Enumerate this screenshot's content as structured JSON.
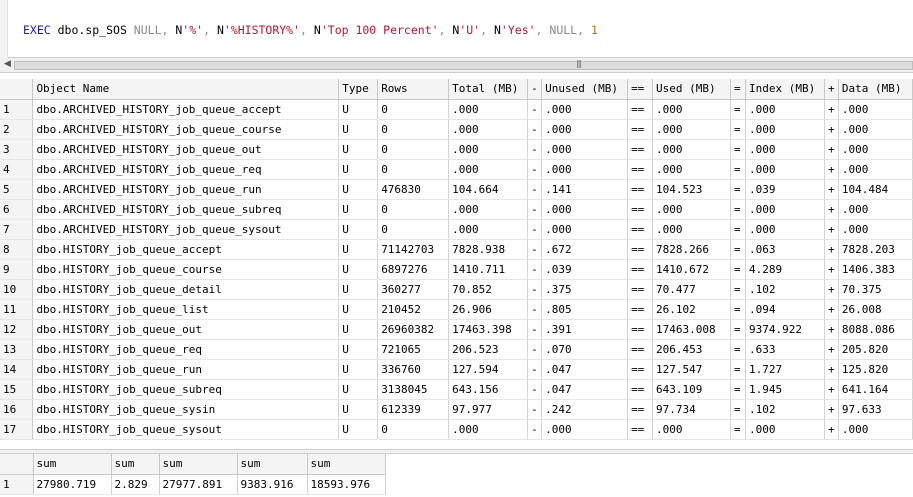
{
  "query": {
    "exec": "EXEC",
    "proc": " dbo.sp_SOS ",
    "null1": "NULL",
    "c1": ", ",
    "n1": "N",
    "s1": "'%'",
    "c2": ", ",
    "n2": "N",
    "s2": "'%HISTORY%'",
    "c3": ", ",
    "n3": "N",
    "s3": "'Top 100 Percent'",
    "c4": ", ",
    "n4": "N",
    "s4": "'U'",
    "c5": ", ",
    "n5": "N",
    "s5": "'Yes'",
    "c6": ", ",
    "null2": "NULL",
    "c7": ", ",
    "last": "1"
  },
  "grid": {
    "headers": [
      "Object Name",
      "Type",
      "Rows",
      "Total (MB)",
      "-",
      "Unused (MB)",
      "==",
      "Used (MB)",
      "=",
      "Index (MB)",
      "+",
      "Data (MB)"
    ],
    "rows": [
      {
        "n": "1",
        "c": [
          "dbo.ARCHIVED_HISTORY_job_queue_accept",
          "U",
          "0",
          ".000",
          "-",
          ".000",
          "==",
          ".000",
          "=",
          ".000",
          "+",
          ".000"
        ]
      },
      {
        "n": "2",
        "c": [
          "dbo.ARCHIVED_HISTORY_job_queue_course",
          "U",
          "0",
          ".000",
          "-",
          ".000",
          "==",
          ".000",
          "=",
          ".000",
          "+",
          ".000"
        ]
      },
      {
        "n": "3",
        "c": [
          "dbo.ARCHIVED_HISTORY_job_queue_out",
          "U",
          "0",
          ".000",
          "-",
          ".000",
          "==",
          ".000",
          "=",
          ".000",
          "+",
          ".000"
        ]
      },
      {
        "n": "4",
        "c": [
          "dbo.ARCHIVED_HISTORY_job_queue_req",
          "U",
          "0",
          ".000",
          "-",
          ".000",
          "==",
          ".000",
          "=",
          ".000",
          "+",
          ".000"
        ]
      },
      {
        "n": "5",
        "c": [
          "dbo.ARCHIVED_HISTORY_job_queue_run",
          "U",
          "476830",
          "104.664",
          "-",
          ".141",
          "==",
          "104.523",
          "=",
          ".039",
          "+",
          "104.484"
        ]
      },
      {
        "n": "6",
        "c": [
          "dbo.ARCHIVED_HISTORY_job_queue_subreq",
          "U",
          "0",
          ".000",
          "-",
          ".000",
          "==",
          ".000",
          "=",
          ".000",
          "+",
          ".000"
        ]
      },
      {
        "n": "7",
        "c": [
          "dbo.ARCHIVED_HISTORY_job_queue_sysout",
          "U",
          "0",
          ".000",
          "-",
          ".000",
          "==",
          ".000",
          "=",
          ".000",
          "+",
          ".000"
        ]
      },
      {
        "n": "8",
        "c": [
          "dbo.HISTORY_job_queue_accept",
          "U",
          "71142703",
          "7828.938",
          "-",
          ".672",
          "==",
          "7828.266",
          "=",
          ".063",
          "+",
          "7828.203"
        ]
      },
      {
        "n": "9",
        "c": [
          "dbo.HISTORY_job_queue_course",
          "U",
          "6897276",
          "1410.711",
          "-",
          ".039",
          "==",
          "1410.672",
          "=",
          "4.289",
          "+",
          "1406.383"
        ]
      },
      {
        "n": "10",
        "c": [
          "dbo.HISTORY_job_queue_detail",
          "U",
          "360277",
          "70.852",
          "-",
          ".375",
          "==",
          "70.477",
          "=",
          ".102",
          "+",
          "70.375"
        ]
      },
      {
        "n": "11",
        "c": [
          "dbo.HISTORY_job_queue_list",
          "U",
          "210452",
          "26.906",
          "-",
          ".805",
          "==",
          "26.102",
          "=",
          ".094",
          "+",
          "26.008"
        ]
      },
      {
        "n": "12",
        "c": [
          "dbo.HISTORY_job_queue_out",
          "U",
          "26960382",
          "17463.398",
          "-",
          ".391",
          "==",
          "17463.008",
          "=",
          "9374.922",
          "+",
          "8088.086"
        ]
      },
      {
        "n": "13",
        "c": [
          "dbo.HISTORY_job_queue_req",
          "U",
          "721065",
          "206.523",
          "-",
          ".070",
          "==",
          "206.453",
          "=",
          ".633",
          "+",
          "205.820"
        ]
      },
      {
        "n": "14",
        "c": [
          "dbo.HISTORY_job_queue_run",
          "U",
          "336760",
          "127.594",
          "-",
          ".047",
          "==",
          "127.547",
          "=",
          "1.727",
          "+",
          "125.820"
        ]
      },
      {
        "n": "15",
        "c": [
          "dbo.HISTORY_job_queue_subreq",
          "U",
          "3138045",
          "643.156",
          "-",
          ".047",
          "==",
          "643.109",
          "=",
          "1.945",
          "+",
          "641.164"
        ]
      },
      {
        "n": "16",
        "c": [
          "dbo.HISTORY_job_queue_sysin",
          "U",
          "612339",
          "97.977",
          "-",
          ".242",
          "==",
          "97.734",
          "=",
          ".102",
          "+",
          "97.633"
        ]
      },
      {
        "n": "17",
        "c": [
          "dbo.HISTORY_job_queue_sysout",
          "U",
          "0",
          ".000",
          "-",
          ".000",
          "==",
          ".000",
          "=",
          ".000",
          "+",
          ".000"
        ]
      }
    ]
  },
  "sums": {
    "headers": [
      "sum",
      "sum",
      "sum",
      "sum",
      "sum"
    ],
    "rows": [
      {
        "n": "1",
        "c": [
          "27980.719",
          "2.829",
          "27977.891",
          "9383.916",
          "18593.976"
        ]
      }
    ]
  }
}
